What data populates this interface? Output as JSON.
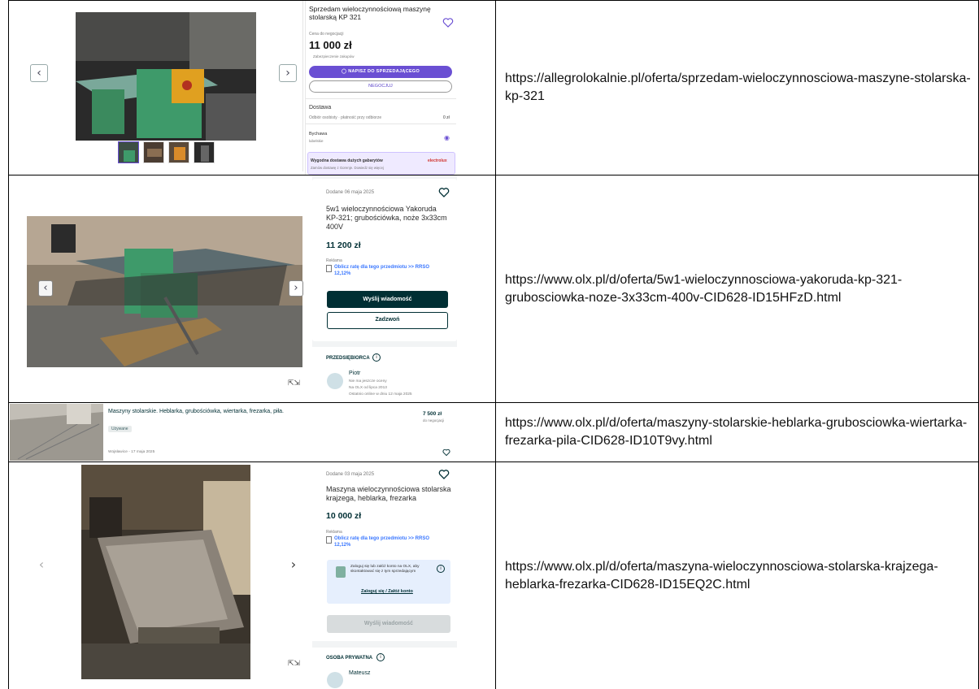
{
  "rows": [
    {
      "url": "https://allegrolokalnie.pl/oferta/sprzedam-wieloczynnosciowa-maszyne-stolarska-kp-321",
      "listing": {
        "title": "Sprzedam wieloczynnościową maszynę stolarską KP 321",
        "negotiable": "Cena do negocjacji",
        "price": "11 000 zł",
        "protection": "Zabezpieczenie zakupów",
        "contact_button": "NAPISZ DO SPRZEDAJĄCEGO",
        "negotiate_button": "NEGOCJUJ",
        "delivery_label": "Dostawa",
        "delivery_option": "Odbiór osobisty · płatność przy odbiorze",
        "delivery_price": "0 zł",
        "location_label": "Bychawa",
        "location_region": "lubelskie",
        "promo_title": "Wygodna dostawa dużych gabarytów",
        "promo_sub": "Zamów dostawę z Gorenje. Dowiedz się więcej",
        "promo_brand": "electrolux"
      }
    },
    {
      "url": "https://www.olx.pl/d/oferta/5w1-wieloczynnosciowa-yakoruda-kp-321-grubosciowka-noze-3x33cm-400v-CID628-ID15HFzD.html",
      "listing": {
        "date": "Dodane 06 maja 2025",
        "title": "5w1 wieloczynnościowa Yakoruda KP-321; grubościówka, noże 3x33cm 400V",
        "price": "11 200 zł",
        "ad_label": "Reklama",
        "calc_text": "Oblicz ratę dla tego przedmiotu >> RRSO 12,12%",
        "message_button": "Wyślij wiadomość",
        "call_button": "Zadzwoń",
        "seller_type": "PRZEDSIĘBIORCA",
        "seller_name": "Piotr",
        "seller_rating": "Nie ma jeszcze oceny",
        "seller_since": "Na OLX od lipca 2013",
        "seller_online": "Ostatnio online w dniu 12 maja 2025"
      }
    },
    {
      "url": "https://www.olx.pl/d/oferta/maszyny-stolarskie-heblarka-grubosciowka-wiertarka-frezarka-pila-CID628-ID10T9vy.html",
      "listing": {
        "title": "Maszyny stolarskie. Heblarka, grubościówka, wiertarka, frezarka, piła.",
        "condition": "Używane",
        "location_date": "Wojsławice - 17 maja 2025",
        "price": "7 500 zł",
        "negotiable": "do negocjacji"
      }
    },
    {
      "url": "https://www.olx.pl/d/oferta/maszyna-wieloczynnosciowa-stolarska-krajzega-heblarka-frezarka-CID628-ID15EQ2C.html",
      "listing": {
        "date": "Dodane 03 maja 2025",
        "title": "Maszyna wieloczynnościowa stolarska krajzega, heblarka, frezarka",
        "price": "10 000 zł",
        "ad_label": "Reklama",
        "calc_text": "Oblicz ratę dla tego przedmiotu >> RRSO 12,12%",
        "login_text": "Zaloguj się lub załóż konto na OLX, aby skontaktować się z tym sprzedającym",
        "login_button": "Zaloguj się / Załóż konto",
        "message_button": "Wyślij wiadomość",
        "seller_type": "OSOBA PRYWATNA",
        "seller_name": "Mateusz"
      }
    }
  ],
  "colors": {
    "allegro_purple": "#6a4fd3",
    "olx_dark": "#002f34",
    "olx_link": "#3a77ff",
    "machine_green": "#3e9a6a"
  }
}
